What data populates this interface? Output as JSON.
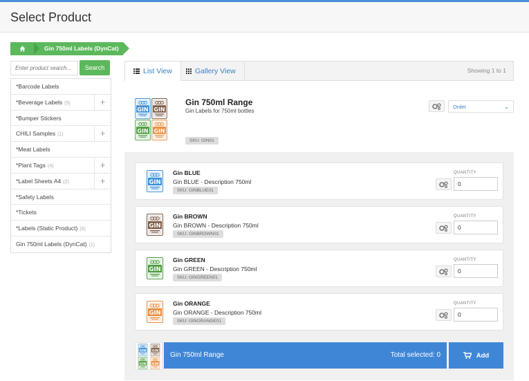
{
  "page": {
    "title": "Select Product"
  },
  "breadcrumb": {
    "home_icon": "home-icon",
    "current": "Gin 750ml Labels (DynCat)"
  },
  "search": {
    "placeholder": "Enter product search...",
    "button_label": "Search"
  },
  "sidebar": {
    "items": [
      {
        "label": "*Barcode Labels",
        "count": "",
        "expandable": false
      },
      {
        "label": "*Beverage Labels",
        "count": "(5)",
        "expandable": true
      },
      {
        "label": "*Bumper Stickers",
        "count": "",
        "expandable": false
      },
      {
        "label": "CHILI Samples",
        "count": "(1)",
        "expandable": true
      },
      {
        "label": "*Meat Labels",
        "count": "",
        "expandable": false
      },
      {
        "label": "*Plant Tags",
        "count": "(4)",
        "expandable": true
      },
      {
        "label": "*Label Sheets A4",
        "count": "(2)",
        "expandable": true
      },
      {
        "label": "*Safety Labels",
        "count": "",
        "expandable": false
      },
      {
        "label": "*Tickets",
        "count": "",
        "expandable": false
      },
      {
        "label": "*Labels (Static Product)",
        "count": "(6)",
        "expandable": false
      },
      {
        "label": "Gin 750ml Labels (DynCat)",
        "count": "(1)",
        "expandable": false
      }
    ],
    "plus_glyph": "+"
  },
  "view_tabs": {
    "list_label": "List View",
    "gallery_label": "Gallery View",
    "showing": "Showing 1 to 1"
  },
  "product": {
    "title": "Gin 750ml Range",
    "subtitle": "Gin Labels for 750ml bottles",
    "sku": "SKU: GIN01",
    "order_select": "Order"
  },
  "variants": [
    {
      "name": "Gin BLUE",
      "description": "Gin BLUE - Description 750ml",
      "sku": "SKU: GINBLUE01",
      "qty_label": "QUANTITY",
      "qty": "0",
      "color": "#3a8fd8"
    },
    {
      "name": "Gin BROWN",
      "description": "Gin BROWN - Description 750ml",
      "sku": "SKU: GINBROWN01",
      "qty_label": "QUANTITY",
      "qty": "0",
      "color": "#7a5a44"
    },
    {
      "name": "Gin GREEN",
      "description": "Gin GREEN - Description 750ml",
      "sku": "SKU: GINGREEN01",
      "qty_label": "QUANTITY",
      "qty": "0",
      "color": "#4b9a3c"
    },
    {
      "name": "Gin ORANGE",
      "description": "Gin ORANGE - Description 750ml",
      "sku": "SKU: GINORANGE01",
      "qty_label": "QUANTITY",
      "qty": "0",
      "color": "#e58a3c"
    }
  ],
  "label_text": "GIN",
  "footer": {
    "title": "Gin 750ml Range",
    "total": "Total selected: 0",
    "add_label": "Add"
  },
  "colors": {
    "accent": "#3f86d6",
    "green": "#5cb85c"
  }
}
